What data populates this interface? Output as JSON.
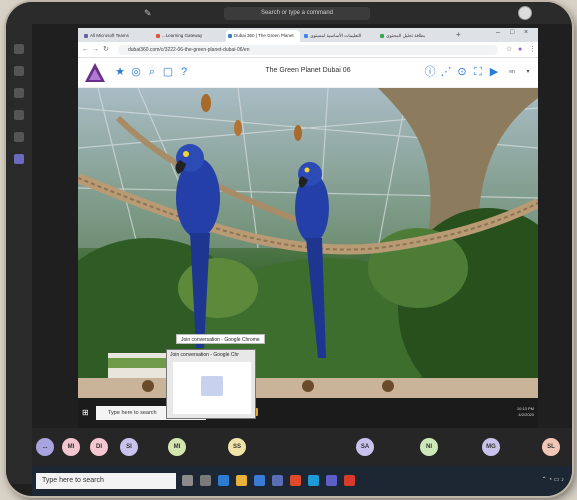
{
  "teams": {
    "search_placeholder": "Search or type a command"
  },
  "browser": {
    "tabs": [
      {
        "label": "All Microsoft Teams",
        "color": "#6264a7"
      },
      {
        "label": "...Learning Gateway",
        "color": "#e2553f"
      },
      {
        "label": "Dubai 360 | The Green Planet",
        "color": "#3b82c4"
      },
      {
        "label": "التعليمات الأساسية لمستوى",
        "color": "#4285f4"
      },
      {
        "label": "بطاقة تحليل المحتوى",
        "color": "#34a853"
      }
    ],
    "url": "dubai360.com/c/3222-06-the-green-planet-dubai-06/en"
  },
  "tour": {
    "title": "The Green Planet Dubai 06",
    "language": "en"
  },
  "tooltip": {
    "text": "Join conversation - Google Chrome"
  },
  "thumbnail": {
    "title": "Join conversation - Google Chr"
  },
  "inner_taskbar": {
    "search_placeholder": "Type here to search",
    "time": "10:13 PM",
    "date": "4/2/2020"
  },
  "participants": [
    {
      "initials": "...",
      "color": "#a9a3df"
    },
    {
      "initials": "MI",
      "color": "#f3c5cf"
    },
    {
      "initials": "DI",
      "color": "#f5c7d2"
    },
    {
      "initials": "SI",
      "color": "#c9c2ec"
    },
    {
      "initials": "MI",
      "color": "#d4e6b0"
    },
    {
      "initials": "SS",
      "color": "#f0e3a8"
    },
    {
      "initials": "SA",
      "color": "#c9c2ec"
    },
    {
      "initials": "NI",
      "color": "#cde8b8"
    },
    {
      "initials": "MG",
      "color": "#c9c2ec"
    },
    {
      "initials": "SL",
      "color": "#f2c6b6"
    }
  ],
  "outer_taskbar": {
    "search_placeholder": "Type here to search"
  }
}
